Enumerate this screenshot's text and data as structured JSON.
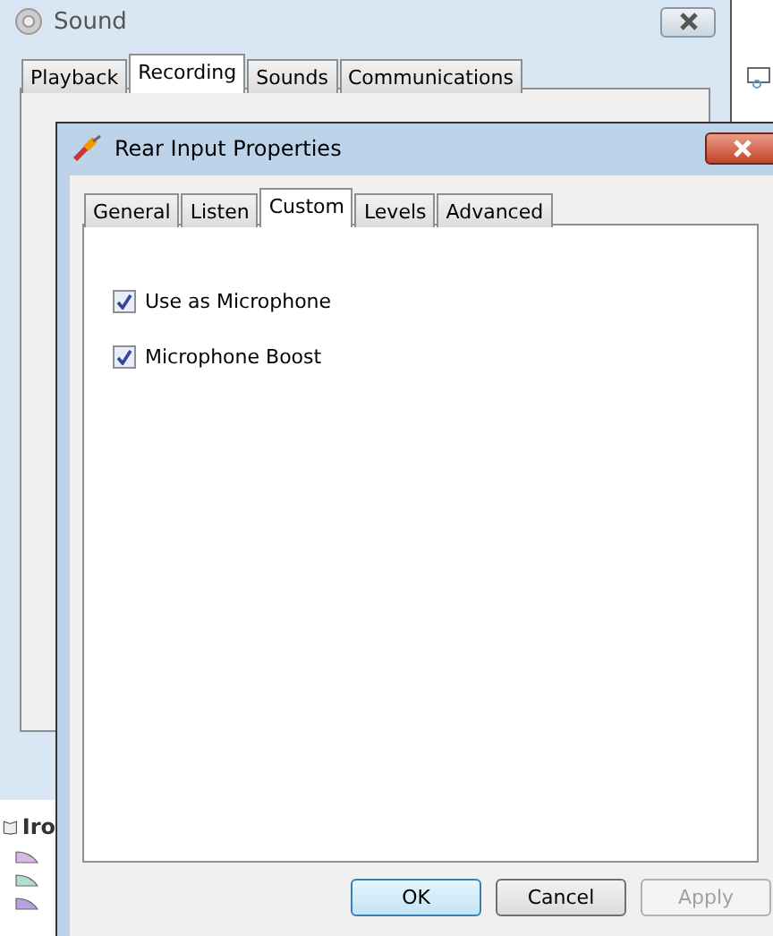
{
  "sound_window": {
    "title": "Sound",
    "tabs": [
      {
        "label": "Playback",
        "selected": false
      },
      {
        "label": "Recording",
        "selected": true
      },
      {
        "label": "Sounds",
        "selected": false
      },
      {
        "label": "Communications",
        "selected": false
      }
    ]
  },
  "background_panel": {
    "title": "Iro"
  },
  "properties_dialog": {
    "title": "Rear Input Properties",
    "tabs": [
      {
        "label": "General",
        "selected": false
      },
      {
        "label": "Listen",
        "selected": false
      },
      {
        "label": "Custom",
        "selected": true
      },
      {
        "label": "Levels",
        "selected": false
      },
      {
        "label": "Advanced",
        "selected": false
      }
    ],
    "options": [
      {
        "label": "Use as Microphone",
        "checked": true
      },
      {
        "label": "Microphone Boost",
        "checked": true
      }
    ],
    "buttons": [
      {
        "label": "OK",
        "kind": "default",
        "disabled": false
      },
      {
        "label": "Cancel",
        "kind": "normal",
        "disabled": false
      },
      {
        "label": "Apply",
        "kind": "normal",
        "disabled": true
      }
    ]
  }
}
